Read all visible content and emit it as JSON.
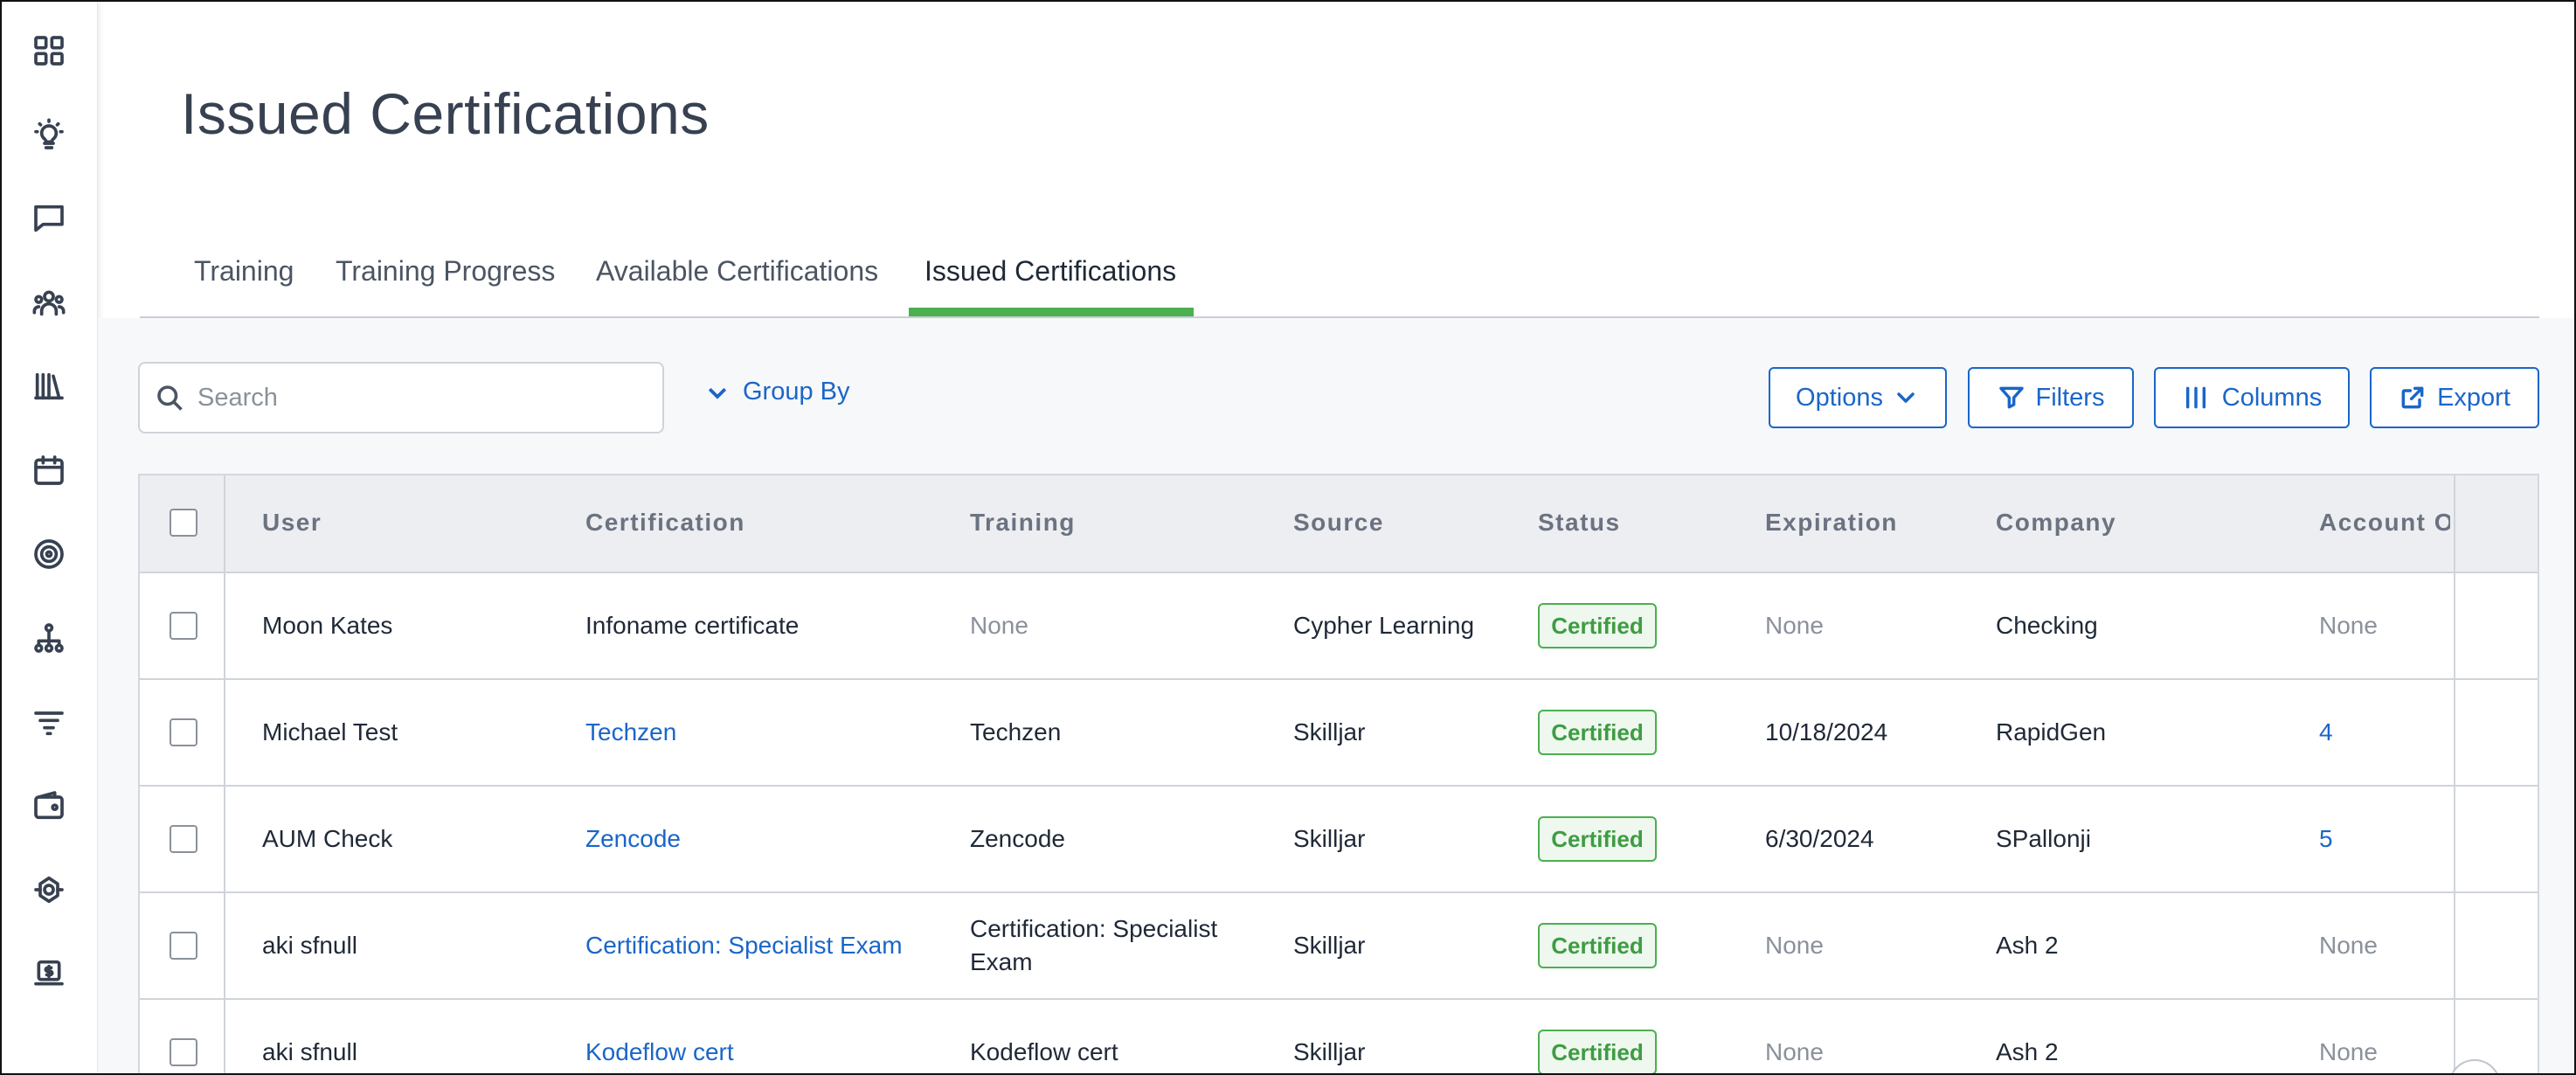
{
  "page": {
    "title": "Issued Certifications"
  },
  "sidebar": {
    "icons": [
      "dashboard-icon",
      "lightbulb-icon",
      "chat-icon",
      "people-icon",
      "library-icon",
      "calendar-icon",
      "target-icon",
      "org-chart-icon",
      "filter-list-icon",
      "wallet-icon",
      "settings-network-icon",
      "billing-icon"
    ]
  },
  "tabs": [
    {
      "label": "Training",
      "active": false
    },
    {
      "label": "Training Progress",
      "active": false
    },
    {
      "label": "Available Certifications",
      "active": false
    },
    {
      "label": "Issued Certifications",
      "active": true
    }
  ],
  "accent_color": "#4caf50",
  "link_color": "#1a66c9",
  "toolbar": {
    "search_placeholder": "Search",
    "search_value": "",
    "group_by_label": "Group By",
    "options_label": "Options",
    "filters_label": "Filters",
    "columns_label": "Columns",
    "export_label": "Export"
  },
  "table": {
    "headers": [
      "User",
      "Certification",
      "Training",
      "Source",
      "Status",
      "Expiration",
      "Company",
      "Account Ov"
    ],
    "rows": [
      {
        "user": "Moon Kates",
        "certification": "Infoname certificate",
        "certification_link": false,
        "training": "None",
        "source": "Cypher Learning",
        "status": "Certified",
        "expiration": "None",
        "company": "Checking",
        "account_owner": "None"
      },
      {
        "user": "Michael Test",
        "certification": "Techzen",
        "certification_link": true,
        "training": "Techzen",
        "source": "Skilljar",
        "status": "Certified",
        "expiration": "10/18/2024",
        "company": "RapidGen",
        "account_owner": "4"
      },
      {
        "user": "AUM Check",
        "certification": "Zencode",
        "certification_link": true,
        "training": "Zencode",
        "source": "Skilljar",
        "status": "Certified",
        "expiration": "6/30/2024",
        "company": "SPallonji",
        "account_owner": "5"
      },
      {
        "user": "aki sfnull",
        "certification": "Certification: Specialist Exam",
        "certification_link": true,
        "training": "Certification: Specialist Exam",
        "source": "Skilljar",
        "status": "Certified",
        "expiration": "None",
        "company": "Ash 2",
        "account_owner": "None"
      },
      {
        "user": "aki sfnull",
        "certification": "Kodeflow cert",
        "certification_link": true,
        "training": "Kodeflow cert",
        "source": "Skilljar",
        "status": "Certified",
        "expiration": "None",
        "company": "Ash 2",
        "account_owner": "None"
      }
    ]
  }
}
